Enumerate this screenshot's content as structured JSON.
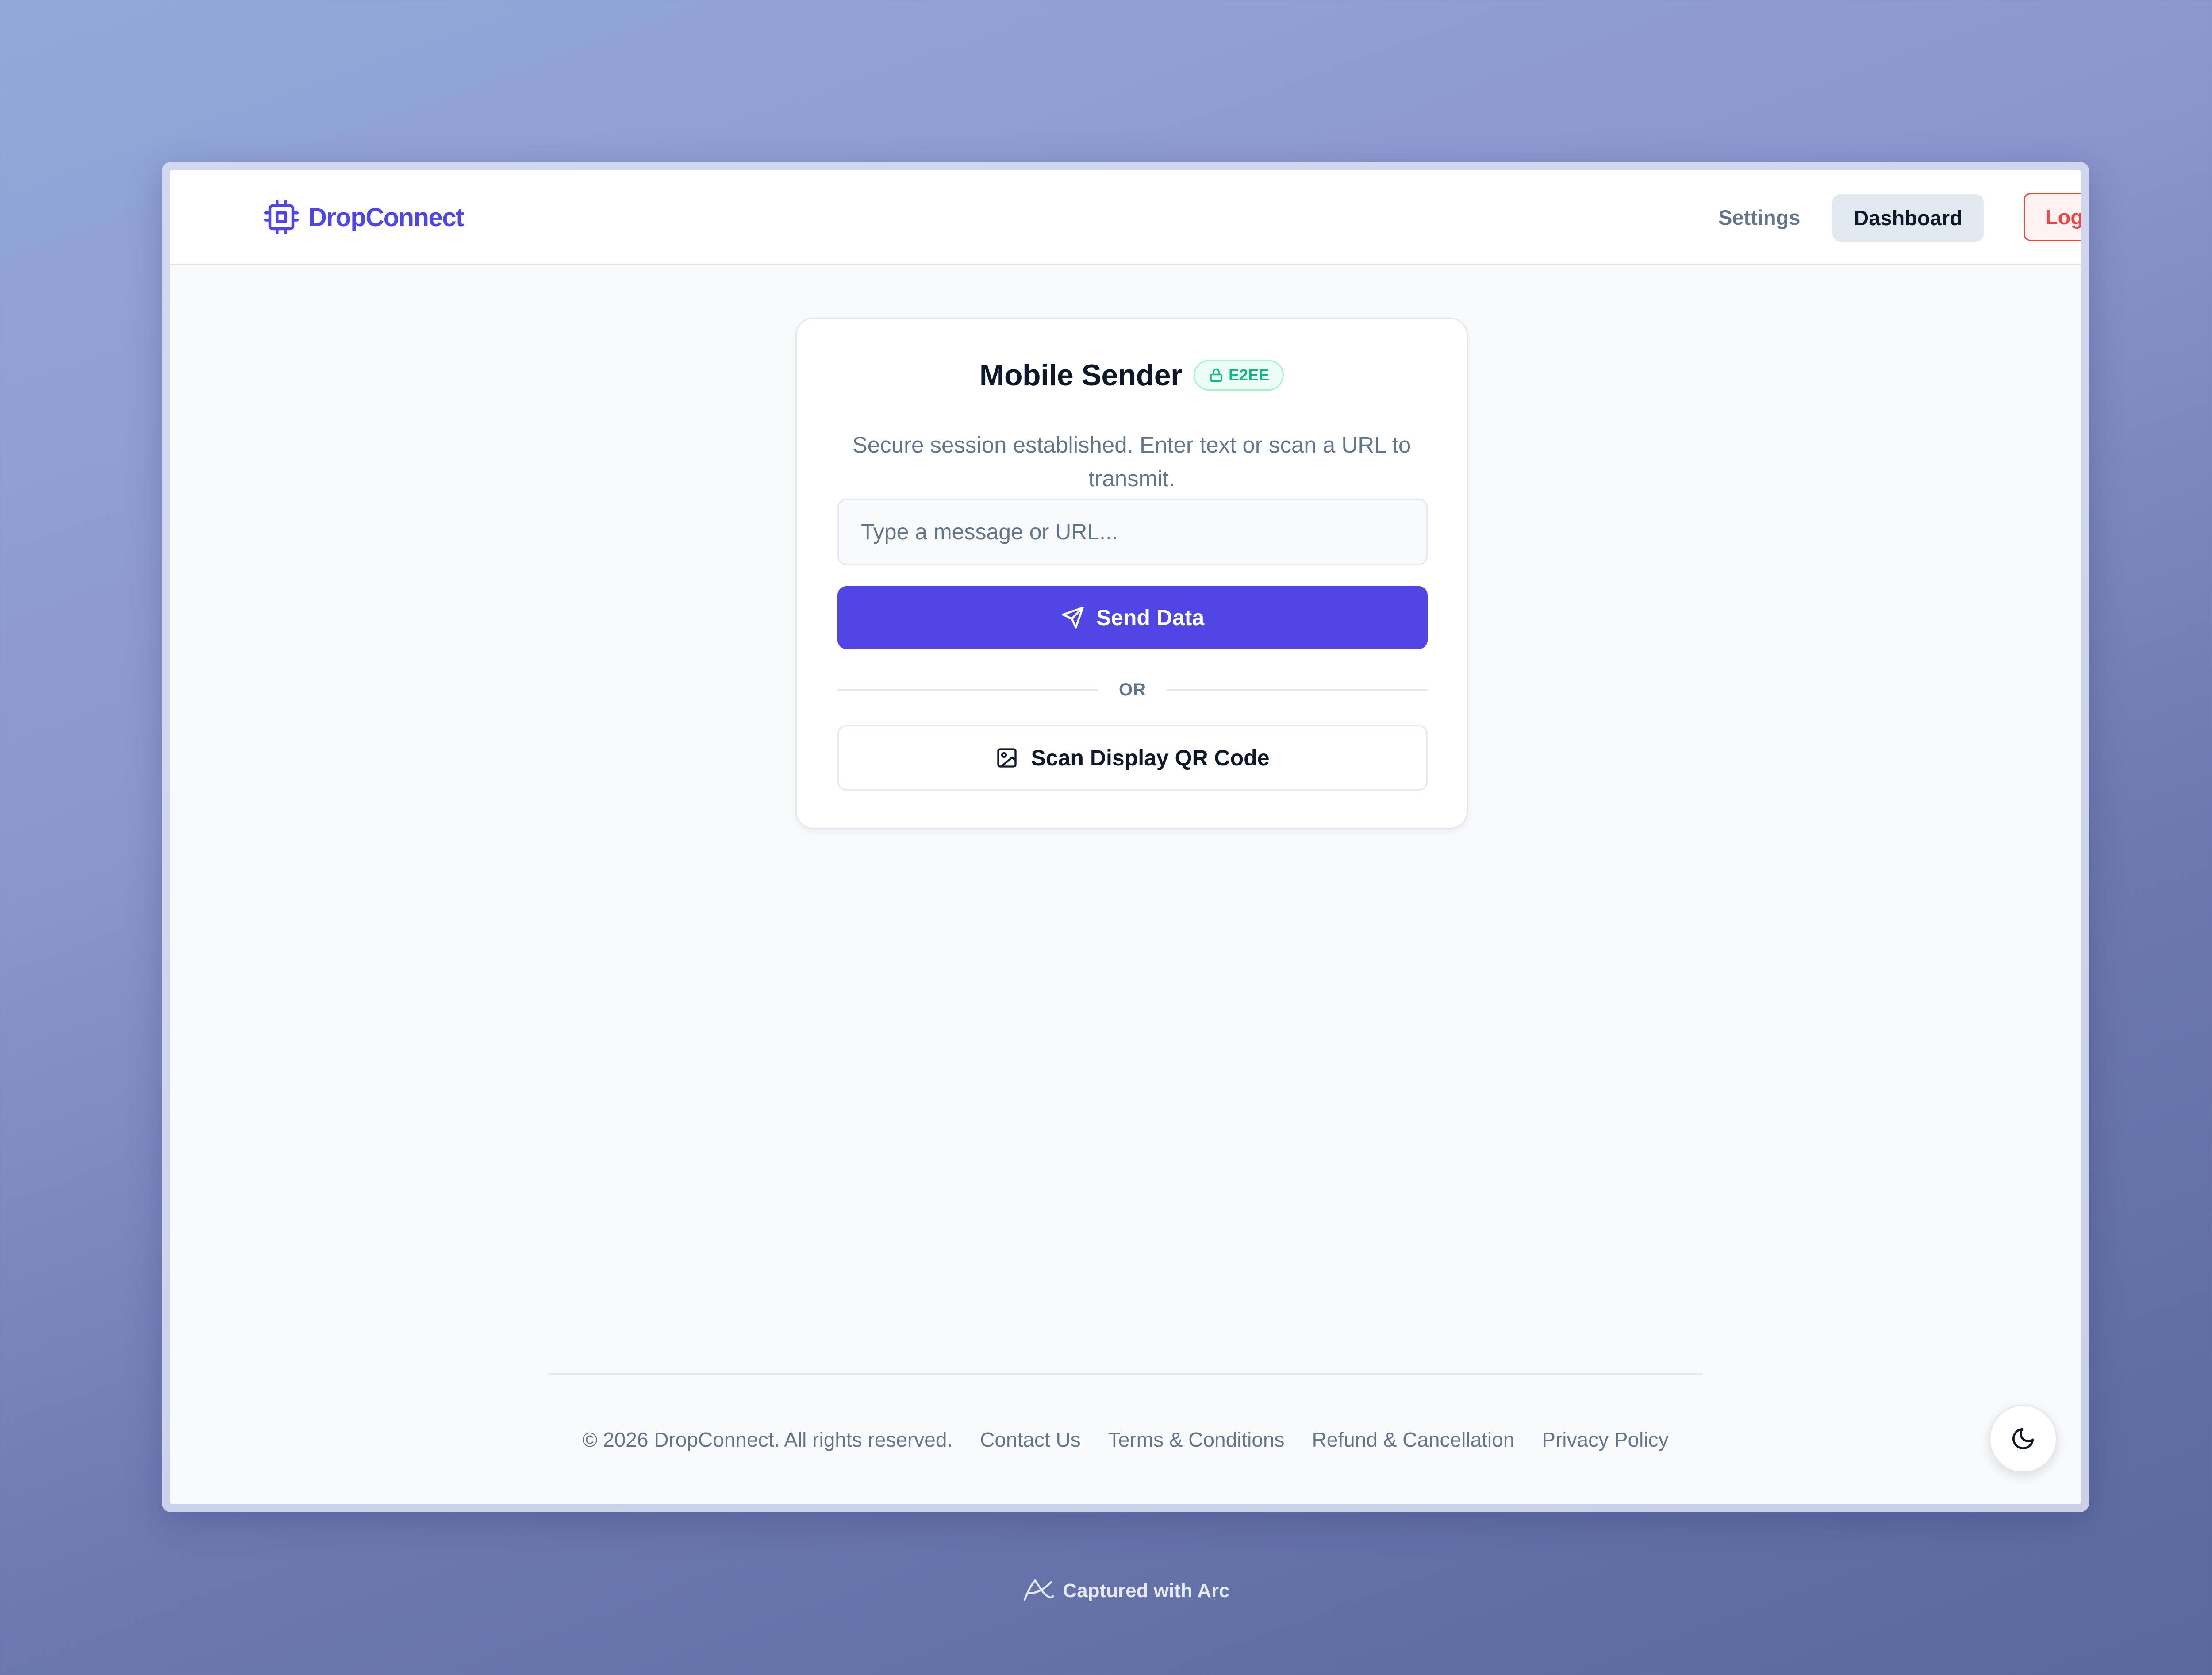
{
  "header": {
    "brand": "DropConnect",
    "nav": {
      "settings": "Settings",
      "dashboard": "Dashboard",
      "logout": "Log Out"
    }
  },
  "card": {
    "title": "Mobile Sender",
    "badge": "E2EE",
    "subtitle": "Secure session established. Enter text or scan a URL to transmit.",
    "input_placeholder": "Type a message or URL...",
    "input_value": "",
    "send_label": "Send Data",
    "divider": "OR",
    "scan_label": "Scan Display QR Code"
  },
  "footer": {
    "copyright": "© 2026 DropConnect. All rights reserved.",
    "links": [
      "Contact Us",
      "Terms & Conditions",
      "Refund & Cancellation",
      "Privacy Policy"
    ]
  },
  "watermark": "Captured with Arc",
  "icons": {
    "brand": "cpu-chip-icon",
    "badge": "lock-icon",
    "send": "send-icon",
    "scan": "image-icon",
    "theme": "moon-icon",
    "watermark": "arc-logo-icon"
  },
  "colors": {
    "accent": "#4f46e5",
    "danger": "#ef4444",
    "success": "#10b981",
    "muted": "#64748b",
    "text": "#0f172a"
  }
}
